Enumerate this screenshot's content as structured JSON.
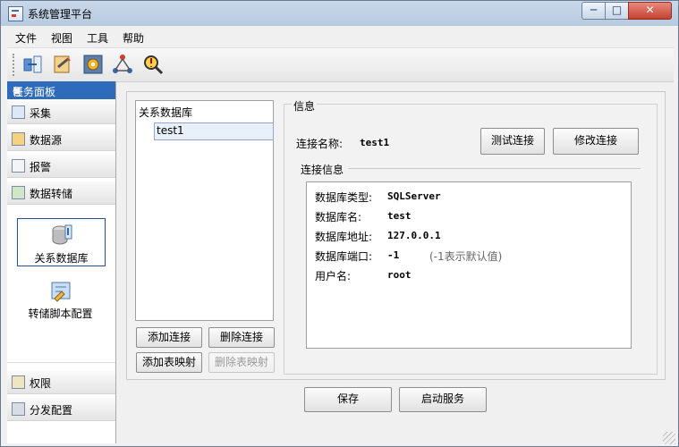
{
  "window": {
    "title": "系统管理平台",
    "controls": [
      "─",
      "□",
      "✕"
    ]
  },
  "menu": [
    "文件",
    "视图",
    "工具",
    "帮助"
  ],
  "toolbar": {
    "icons": [
      "connection-tool-icon",
      "datasource-tool-icon",
      "settings-tool-icon",
      "topology-tool-icon",
      "alarm-search-icon"
    ]
  },
  "taskpane": {
    "title": "任务面板",
    "groups": [
      {
        "label": "采集",
        "icon": "collect-icon"
      },
      {
        "label": "数据源",
        "icon": "datasource-icon"
      },
      {
        "label": "报警",
        "icon": "alarm-icon"
      },
      {
        "label": "数据转储",
        "icon": "data-transfer-icon"
      }
    ],
    "nav_items": [
      {
        "label": "关系数据库",
        "icon": "database-icon",
        "selected": true
      },
      {
        "label": "转储脚本配置",
        "icon": "script-config-icon",
        "selected": false
      }
    ],
    "bottom_groups": [
      {
        "label": "权限",
        "icon": "permission-icon"
      },
      {
        "label": "分发配置",
        "icon": "distribution-icon"
      }
    ]
  },
  "db_list": {
    "header": "关系数据库",
    "items": [
      "test1"
    ],
    "selected": "test1"
  },
  "list_buttons": {
    "add_connection": "添加连接",
    "delete_connection": "删除连接",
    "add_table_mapping": "添加表映射",
    "delete_table_mapping": "删除表映射"
  },
  "info": {
    "legend": "信息",
    "connection_name_label": "连接名称:",
    "connection_name_value": "test1",
    "test_connection": "测试连接",
    "modify_connection": "修改连接",
    "details_legend": "连接信息",
    "details": [
      {
        "label": "数据库类型:",
        "value": "SQLServer"
      },
      {
        "label": "数据库名:",
        "value": "test"
      },
      {
        "label": "数据库地址:",
        "value": "127.0.0.1"
      },
      {
        "label": "数据库端口:",
        "value": "-1",
        "hint": "(-1表示默认值)"
      },
      {
        "label": "用户名:",
        "value": "root"
      }
    ]
  },
  "footer": {
    "save": "保存",
    "start_service": "启动服务"
  },
  "colors": {
    "taskpane_title": "#2f6bbb",
    "selection_border": "#284f90"
  }
}
